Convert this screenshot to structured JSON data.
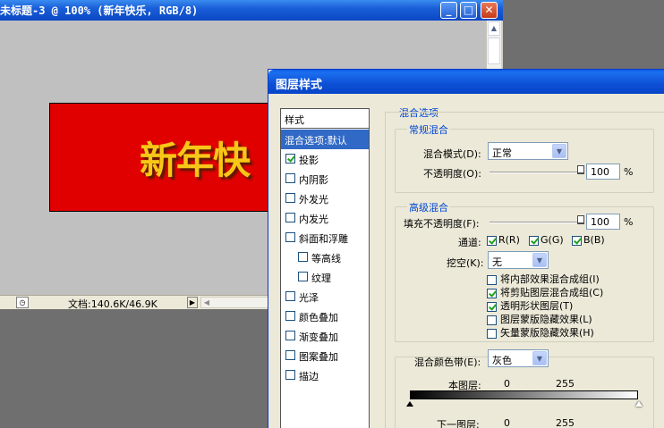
{
  "document_window": {
    "title": "未标题-3 @ 100% (新年快乐, RGB/8)",
    "banner_text": "新年快",
    "status_text": "文档:140.6K/46.9K",
    "minimize_symbol": "_",
    "maximize_symbol": "□",
    "close_symbol": "✕"
  },
  "dialog": {
    "title": "图层样式",
    "styles_header": "样式",
    "styles": [
      {
        "label": "混合选项:默认",
        "checkbox": false,
        "selected": true
      },
      {
        "label": "投影",
        "checkbox": true,
        "checked": true
      },
      {
        "label": "内阴影",
        "checkbox": true,
        "checked": false
      },
      {
        "label": "外发光",
        "checkbox": true,
        "checked": false
      },
      {
        "label": "内发光",
        "checkbox": true,
        "checked": false
      },
      {
        "label": "斜面和浮雕",
        "checkbox": true,
        "checked": false
      },
      {
        "label": "等高线",
        "checkbox": true,
        "checked": false,
        "indent": true
      },
      {
        "label": "纹理",
        "checkbox": true,
        "checked": false,
        "indent": true
      },
      {
        "label": "光泽",
        "checkbox": true,
        "checked": false
      },
      {
        "label": "颜色叠加",
        "checkbox": true,
        "checked": false
      },
      {
        "label": "渐变叠加",
        "checkbox": true,
        "checked": false
      },
      {
        "label": "图案叠加",
        "checkbox": true,
        "checked": false
      },
      {
        "label": "描边",
        "checkbox": true,
        "checked": false
      }
    ],
    "blend_options": {
      "legend": "混合选项",
      "general": {
        "legend": "常规混合",
        "blend_mode_label": "混合模式(D):",
        "blend_mode_value": "正常",
        "opacity_label": "不透明度(O):",
        "opacity_value": "100",
        "opacity_unit": "%",
        "opacity_level": 1.0
      },
      "advanced": {
        "legend": "高级混合",
        "fill_opacity_label": "填充不透明度(F):",
        "fill_opacity_value": "100",
        "fill_opacity_unit": "%",
        "fill_opacity_level": 1.0,
        "channels_label": "通道:",
        "channels": [
          {
            "label": "R(R)",
            "checked": true
          },
          {
            "label": "G(G)",
            "checked": true
          },
          {
            "label": "B(B)",
            "checked": true
          }
        ],
        "knockout_label": "挖空(K):",
        "knockout_value": "无",
        "options": [
          {
            "label": "将内部效果混合成组(I)",
            "checked": false
          },
          {
            "label": "将剪贴图层混合成组(C)",
            "checked": true
          },
          {
            "label": "透明形状图层(T)",
            "checked": true
          },
          {
            "label": "图层蒙版隐藏效果(L)",
            "checked": false
          },
          {
            "label": "矢量蒙版隐藏效果(H)",
            "checked": false
          }
        ]
      },
      "blend_if": {
        "label": "混合颜色带(E):",
        "value": "灰色",
        "this_layer_label": "本图层:",
        "this_layer_min": "0",
        "this_layer_max": "255",
        "underlying_label": "下一图层:",
        "underlying_min": "0",
        "underlying_max": "255"
      }
    }
  }
}
